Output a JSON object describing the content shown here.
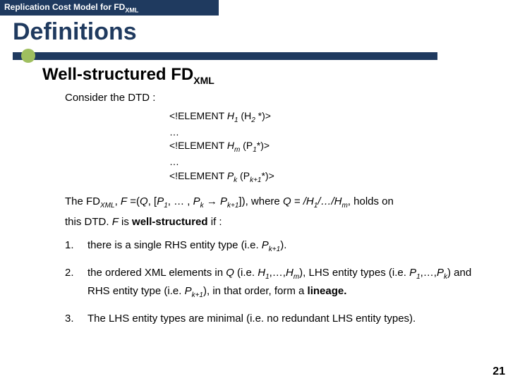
{
  "header": {
    "prefix": "Replication Cost Model for FD",
    "sub": "XML"
  },
  "title": "Definitions",
  "subtitle": {
    "prefix": "Well-structured FD",
    "sub": "XML"
  },
  "consider": "Consider the DTD :",
  "dtd": {
    "l1a": "<!ELEMENT ",
    "l1b": "H",
    "l1sub": "1",
    "l1c": " (H",
    "l1sub2": "2",
    "l1d": " *)>",
    "dots1": "…",
    "l2a": "<!ELEMENT ",
    "l2b": "H",
    "l2sub": "m",
    "l2c": " (P",
    "l2sub2": "1",
    "l2d": "*)>",
    "dots2": "…",
    "l3a": "<!ELEMENT ",
    "l3b": "P",
    "l3sub": "k",
    "l3c": " (P",
    "l3sub2": "k+1",
    "l3d": "*)>"
  },
  "para": {
    "p1": "The FD",
    "p1sub": "XML",
    "p2": ", ",
    "p3": "F",
    "p4": " =(",
    "p5": "Q",
    "p6": ", [",
    "p7": "P",
    "p7sub": "1",
    "p8": ", … , ",
    "p9": "P",
    "p9sub": "k",
    "arrow": " → ",
    "p10": "P",
    "p10sub": "k+1",
    "p11": "]), where ",
    "p12": "Q = /H",
    "p12sub": "1",
    "p13": "/…/H",
    "p13sub": "m",
    "p14": ", holds on",
    "p15": "this DTD. ",
    "p16": "F",
    "p17": " is ",
    "p18": "well-structured",
    "p19": " if :"
  },
  "list": {
    "n1": "1.",
    "t1a": "there is a single RHS entity type (i.e. ",
    "t1b": "P",
    "t1bsub": "k+1",
    "t1c": ").",
    "n2": "2.",
    "t2a": "the ordered XML elements in ",
    "t2b": "Q",
    "t2c": " (i.e. ",
    "t2d": "H",
    "t2dsub": "1",
    "t2e": ",…,",
    "t2f": "H",
    "t2fsub": "m",
    "t2g": "), LHS entity types (i.e. ",
    "t2h": "P",
    "t2hsub": "1",
    "t2i": ",…,",
    "t2j": "P",
    "t2jsub": "k",
    "t2k": ") and RHS entity type (i.e. ",
    "t2l": "P",
    "t2lsub": "k+1",
    "t2m": "), in that order, form a ",
    "t2n": "lineage.",
    "n3": "3.",
    "t3": "The LHS entity types are minimal (i.e. no redundant LHS entity types)."
  },
  "page": "21"
}
